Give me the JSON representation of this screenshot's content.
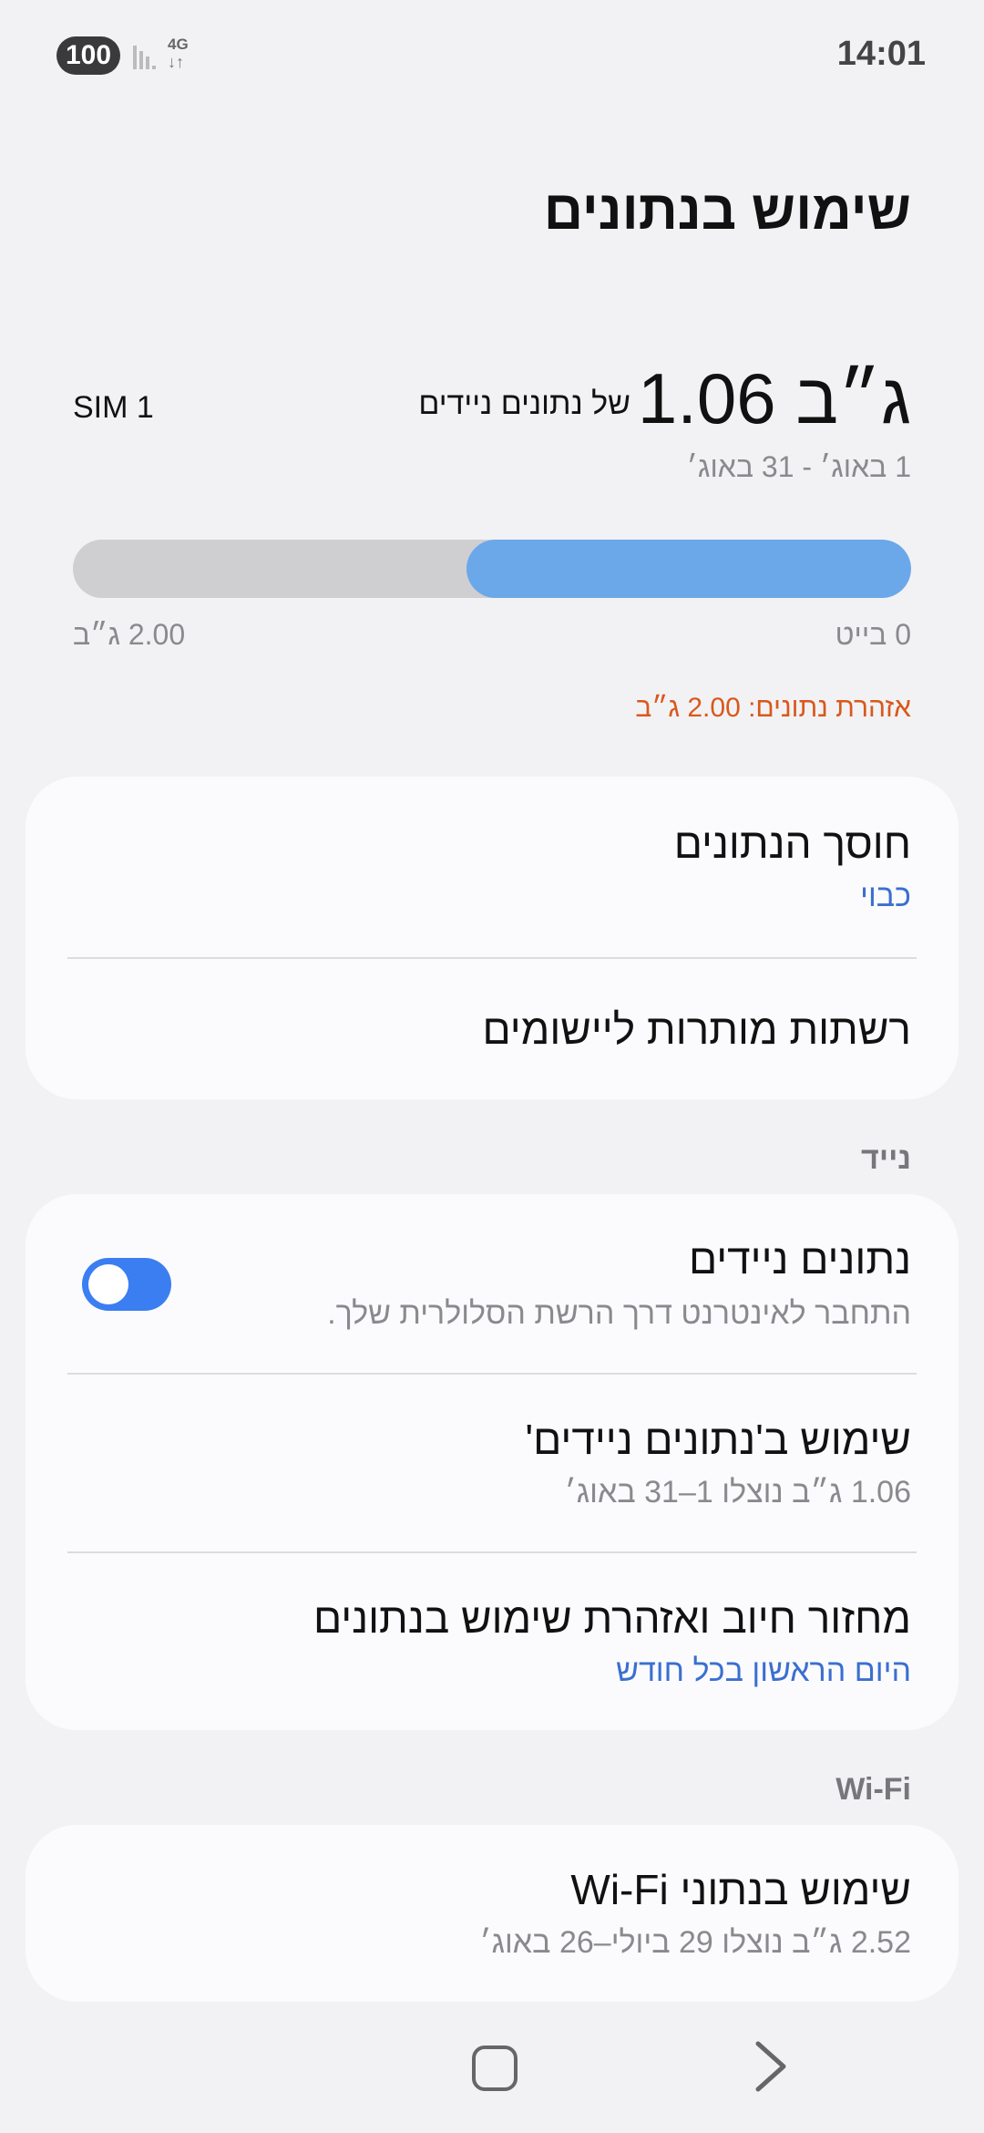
{
  "status_bar": {
    "battery": "100",
    "network_type": "4G",
    "time": "14:01"
  },
  "page": {
    "title": "שימוש בנתונים"
  },
  "usage": {
    "amount": "1.06 ג״ב",
    "suffix": "של נתונים ניידים",
    "sim": "SIM 1",
    "range": "1 באוג׳ - 31 באוג׳",
    "used_fraction": 0.53,
    "bar_min_label": "0 בייט",
    "bar_max_label": "2.00 ג״ב",
    "warning": "אזהרת נתונים: 2.00 ג״ב",
    "colors": {
      "fill": "#6aa8ea",
      "track": "#cfcfd1",
      "warning": "#d9581c"
    }
  },
  "card1": {
    "data_saver": {
      "title": "חוסך הנתונים",
      "status": "כבוי"
    },
    "allowed_networks": {
      "title": "רשתות מותרות ליישומים"
    }
  },
  "mobile_section": {
    "label": "נייד",
    "mobile_data": {
      "title": "נתונים ניידים",
      "subtitle": "התחבר לאינטרנט דרך הרשת הסלולרית שלך.",
      "enabled": true
    },
    "mobile_usage": {
      "title": "שימוש ב'נתונים ניידים'",
      "subtitle": "1.06 ג״ב נוצלו 1–31 באוג׳"
    },
    "billing_cycle": {
      "title": "מחזור חיוב ואזהרת שימוש בנתונים",
      "subtitle": "היום הראשון בכל חודש"
    }
  },
  "wifi_section": {
    "label": "Wi-Fi",
    "wifi_usage": {
      "title": "שימוש בנתוני Wi-Fi",
      "subtitle": "2.52 ג״ב נוצלו 29 ביולי–26 באוג׳"
    }
  },
  "nav_bar": {
    "home_icon": "square-home-icon",
    "back_icon": "chevron-back-icon"
  }
}
